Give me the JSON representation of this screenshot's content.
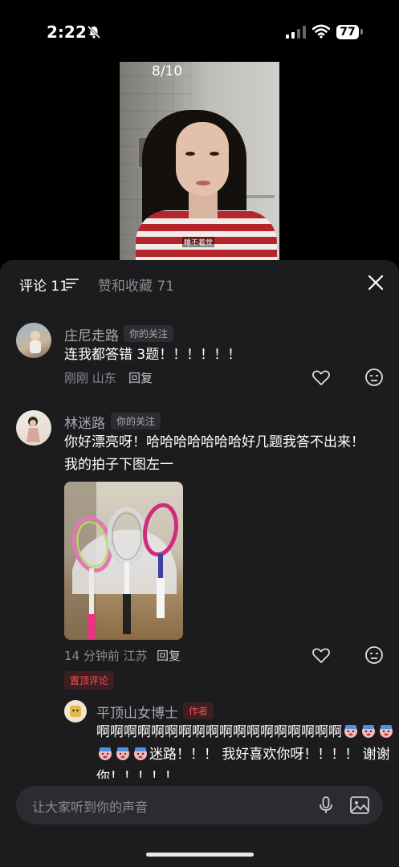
{
  "status_bar": {
    "time": "2:22",
    "battery": "77"
  },
  "video": {
    "counter": "8/10",
    "subtitle": "睡不着觉"
  },
  "comments_panel": {
    "tab_comments": "评论 11",
    "tab_likes": "赞和收藏 71"
  },
  "comments": [
    {
      "name": "庄尼走路",
      "badge": "你的关注",
      "text": "连我都答错 3题！！！！！！",
      "time_loc": "刚刚 山东",
      "reply": "回复"
    },
    {
      "name": "林迷路",
      "badge": "你的关注",
      "text_line1": "你好漂亮呀！哈哈哈哈哈哈哈好几题我答不出来！",
      "text_line2": "我的拍子下图左一",
      "time_loc": "14 分钟前 江苏",
      "reply": "回复",
      "pinned": "置顶评论"
    }
  ],
  "author_reply": {
    "name": "平顶山女博士",
    "tag": "作者",
    "line1": "啊啊啊啊啊啊啊啊啊啊啊啊啊啊啊啊啊啊",
    "line2_text": "迷路！！！ 我好喜欢你呀！！！！ 谢谢",
    "line3": "你！！！！！"
  },
  "input": {
    "placeholder": "让大家听到你的声音"
  },
  "colors": {
    "sheet_bg": "#1c1c1f",
    "accent_red": "#ff4d4f",
    "muted": "#8b8b90"
  }
}
